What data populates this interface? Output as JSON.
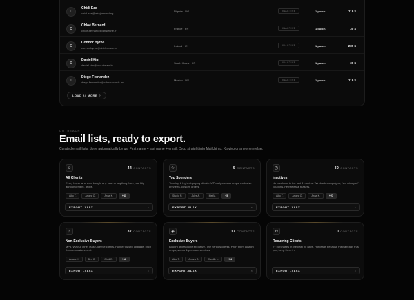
{
  "table": {
    "rows": [
      {
        "initial": "C",
        "name": "Chidi Eze",
        "email": "chidi.eze@afrojamsmd.ng",
        "country": "Nigeria · NG",
        "status": "INACTIVE",
        "purchases": "1 purch.",
        "amount": "119 $"
      },
      {
        "initial": "C",
        "name": "Chloé Bernard",
        "email": "chloe.bernard@parisienne.fr",
        "country": "France · FR",
        "status": "INACTIVE",
        "purchases": "1 purch.",
        "amount": "30 $"
      },
      {
        "initial": "C",
        "name": "Connor Byrne",
        "email": "connor.byrne@dublinwave.ie",
        "country": "Ireland · IE",
        "status": "INACTIVE",
        "purchases": "1 purch.",
        "amount": "289 $"
      },
      {
        "initial": "D",
        "name": "Daniel Kim",
        "email": "daniel.kim@seoulbeats.kr",
        "country": "South Korea · KR",
        "status": "INACTIVE",
        "purchases": "1 purch.",
        "amount": "30 $"
      },
      {
        "initial": "D",
        "name": "Diego Fernandez",
        "email": "diego.fernandez@cdmxrecords.mx",
        "country": "Mexico · MX",
        "status": "INACTIVE",
        "purchases": "1 purch.",
        "amount": "119 $"
      }
    ],
    "load_more": "LOAD 24 MORE",
    "load_more_icon": "chevron-right-icon"
  },
  "section": {
    "eyebrow": "OUTREACH",
    "title": "Email lists, ready to export.",
    "subtitle": "Curated email lists, done automatically by us. First name + last name + email. Drop straight into Mailchimp, Klaviyo or anywhere else."
  },
  "cards": [
    {
      "icon": "users-icon",
      "glyph": "☺",
      "count": "44",
      "count_label": "CONTACTS",
      "title": "All Clients",
      "desc": "Every buyer who ever bought any beat or anything from you. Big announcement, drops.",
      "chips": [
        "Aiko T.",
        "Amara O.",
        "Anna K."
      ],
      "more": "+41",
      "export": "EXPORT .XLSX"
    },
    {
      "icon": "star-icon",
      "glyph": "☆",
      "count": "5",
      "count_label": "CONTACTS",
      "title": "Top Spenders",
      "desc": "Your top 8 highest-paying clients. VIP early-access drops, exclusive previews, custom orders.",
      "chips": [
        "Studio N.",
        "Jules A.",
        "Mei M."
      ],
      "more": "+5",
      "export": "EXPORT .XLSX"
    },
    {
      "icon": "clock-icon",
      "glyph": "◷",
      "count": "30",
      "count_label": "CONTACTS",
      "title": "Inactives",
      "desc": "No purchase in the last 3 months. Win-back campaigns, \"we miss you\" coupons, new release teasers.",
      "chips": [
        "Aiko T.",
        "Amara O.",
        "Anna K."
      ],
      "more": "+27",
      "export": "EXPORT .XLSX"
    },
    {
      "icon": "music-note-icon",
      "glyph": "♫",
      "count": "37",
      "count_label": "CONTACTS",
      "title": "Non-Exclusive Buyers",
      "desc": "MP3, WAV & other lease-license clients. Funnel toward upgrade, pitch them exclusives next.",
      "chips": [
        "Amara K.",
        "Ben C.",
        "Chidi E."
      ],
      "more": "+34",
      "export": "EXPORT .XLSX"
    },
    {
      "icon": "diamond-icon",
      "glyph": "◈",
      "count": "17",
      "count_label": "CONTACTS",
      "title": "Exclusive Buyers",
      "desc": "Bought at least one exclusive. The serious clients. Pitch them custom drops, stems & premium services.",
      "chips": [
        "Aiko T.",
        "Amara O.",
        "Camille L."
      ],
      "more": "+14",
      "export": "EXPORT .XLSX"
    },
    {
      "icon": "refresh-icon",
      "glyph": "↻",
      "count": "0",
      "count_label": "CONTACTS",
      "title": "Recurring Clients",
      "desc": "2+ purchases in the past 90 days. Hot leads because they already trust you, keep them in.",
      "chips": [],
      "more": "",
      "export": "EXPORT .XLSX"
    }
  ],
  "export_icon": "close-icon"
}
